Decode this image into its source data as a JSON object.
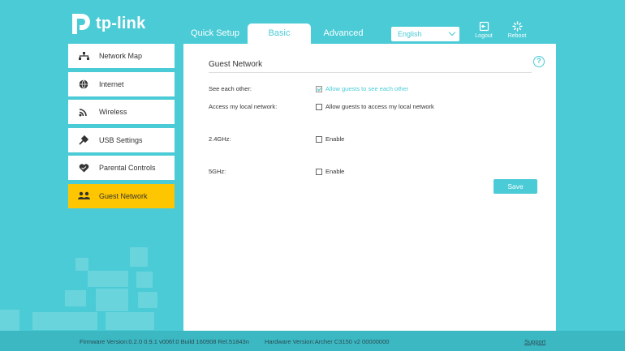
{
  "brand": {
    "name": "tp-link"
  },
  "nav": {
    "tabs": [
      {
        "label": "Quick Setup"
      },
      {
        "label": "Basic"
      },
      {
        "label": "Advanced"
      }
    ],
    "language": "English",
    "logout_label": "Logout",
    "reboot_label": "Reboot"
  },
  "sidebar": {
    "items": [
      {
        "label": "Network Map",
        "icon": "network-map-icon"
      },
      {
        "label": "Internet",
        "icon": "globe-icon"
      },
      {
        "label": "Wireless",
        "icon": "wifi-icon"
      },
      {
        "label": "USB Settings",
        "icon": "usb-icon"
      },
      {
        "label": "Parental Controls",
        "icon": "heart-icon"
      },
      {
        "label": "Guest Network",
        "icon": "guests-icon",
        "active": true
      }
    ]
  },
  "main": {
    "title": "Guest Network",
    "rows": [
      {
        "label": "See each other:",
        "option": "Allow guests to see each other",
        "checked": true
      },
      {
        "label": "Access my local network:",
        "option": "Allow guests to access my local network",
        "checked": false
      },
      {
        "label": "2.4GHz:",
        "option": "Enable",
        "checked": false
      },
      {
        "label": "5GHz:",
        "option": "Enable",
        "checked": false
      }
    ],
    "save_label": "Save"
  },
  "footer": {
    "firmware": "Firmware Version:0.2.0 0.9.1 v006f.0 Build 160908 Rel.51843n",
    "hardware": "Hardware Version:Archer C3150 v2 00000000",
    "support": "Support"
  },
  "colors": {
    "accent": "#4acbd6",
    "active": "#fec600"
  }
}
